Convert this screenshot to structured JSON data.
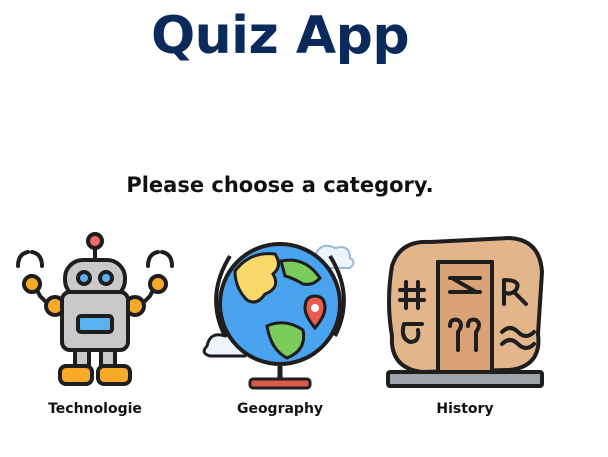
{
  "header": {
    "title": "Quiz App"
  },
  "prompt": "Please choose a category.",
  "categories": [
    {
      "label": "Technologie",
      "icon": "robot-icon"
    },
    {
      "label": "Geography",
      "icon": "globe-icon"
    },
    {
      "label": "History",
      "icon": "stone-tablet-icon"
    }
  ]
}
